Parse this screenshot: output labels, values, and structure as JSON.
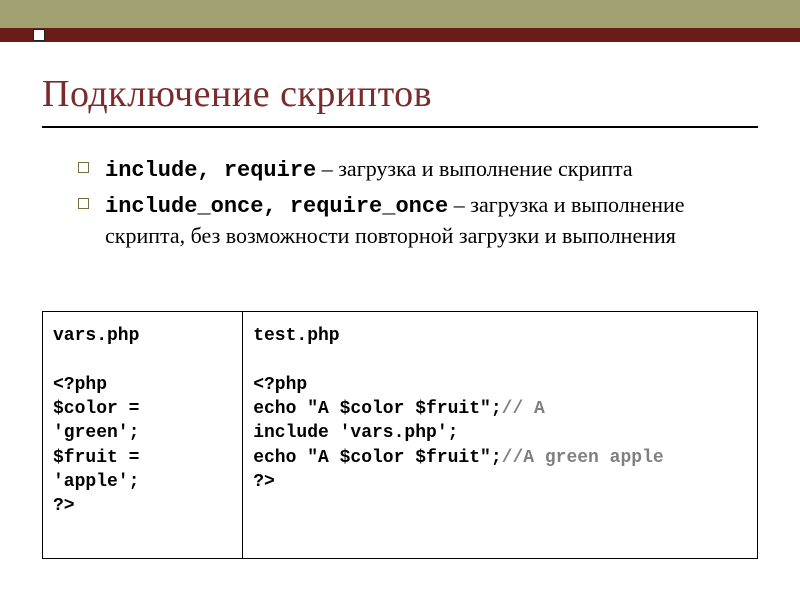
{
  "title": "Подключение скриптов",
  "bullets": [
    {
      "keywords": "include, require",
      "desc": " – загрузка и выполнение скрипта"
    },
    {
      "keywords": "include_once, require_once",
      "desc": " – загрузка и выполнение скрипта, без возможности повторной загрузки и выполнения"
    }
  ],
  "code_left": {
    "filename": "vars.php",
    "l1": "<?php",
    "l2": "$color = 'green';",
    "l3": "$fruit = 'apple';",
    "l4": "?>"
  },
  "code_right": {
    "filename": "test.php",
    "l1": "<?php",
    "l2a": "echo \"A $color $fruit\";",
    "l2c": "// A",
    "l3": "include 'vars.php';",
    "l4a": "echo \"A $color $fruit\";",
    "l4c": "//A green apple",
    "l5": "?>"
  }
}
